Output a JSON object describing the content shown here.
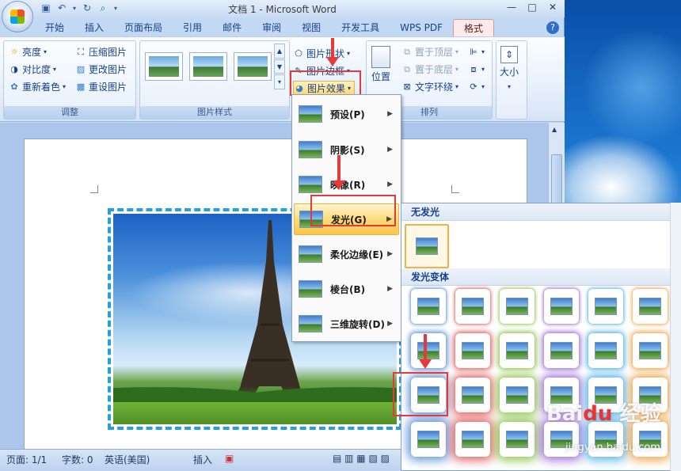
{
  "window": {
    "title": "文档 1 - Microsoft Word"
  },
  "tabs": [
    "开始",
    "插入",
    "页面布局",
    "引用",
    "邮件",
    "审阅",
    "视图",
    "开发工具",
    "WPS PDF",
    "格式"
  ],
  "ribbon": {
    "adjust": {
      "label": "调整",
      "brightness": "亮度",
      "contrast": "对比度",
      "recolor": "重新着色",
      "compress": "压缩图片",
      "change": "更改图片",
      "reset": "重设图片"
    },
    "styles": {
      "label": "图片样式",
      "shape": "图片形状",
      "border": "图片边框",
      "effects": "图片效果"
    },
    "arrange": {
      "label": "排列",
      "position": "位置",
      "front": "置于顶层",
      "back": "置于底层",
      "wrap": "文字环绕"
    },
    "size": {
      "label": "大小"
    }
  },
  "effects_menu": {
    "items": [
      "预设(P)",
      "阴影(S)",
      "映像(R)",
      "发光(G)",
      "柔化边缘(E)",
      "棱台(B)",
      "三维旋转(D)"
    ]
  },
  "glow_panel": {
    "none_header": "无发光",
    "variants_header": "发光变体",
    "colors": [
      "#5b8fd6",
      "#e05a5a",
      "#8cc34a",
      "#9a6ad6",
      "#4fb0e8",
      "#f2a040"
    ]
  },
  "status": {
    "page": "页面: 1/1",
    "words": "字数: 0",
    "lang": "英语(美国)",
    "insert": "插入"
  },
  "watermark": {
    "brand": "Baidu 经验",
    "url": "jingyan.baidu.com"
  }
}
